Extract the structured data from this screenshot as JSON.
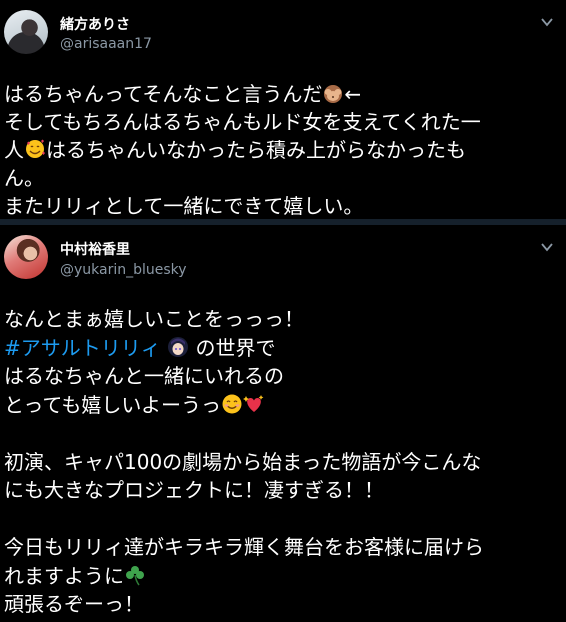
{
  "tweets": [
    {
      "display_name": "緒方ありさ",
      "handle": "@arisaaan17",
      "lines": {
        "l1": "はるちゃんってそんなこと言うんだ",
        "l1_arrow": "←",
        "l2": "そしてもちろんはるちゃんもルド女を支えてくれた一",
        "l3a": "人",
        "l3b": "はるちゃんいなかったら積み上がらなかったも",
        "l4": "ん。",
        "l5": "またリリィとして一緒にできて嬉しい。"
      }
    },
    {
      "display_name": "中村裕香里",
      "handle": "@yukarin_bluesky",
      "lines": {
        "l1": "なんとまぁ嬉しいことをっっっ！",
        "hashtag": "#アサルトリリィ",
        "l2b": "の世界で",
        "l3": "はるなちゃんと一緒にいれるの",
        "l4": "とっても嬉しいよーうっ",
        "l5": "初演、キャパ100の劇場から始まった物語が今こんな",
        "l6": "にも大きなプロジェクトに！凄すぎる！！",
        "l7": "今日もリリィ達がキラキラ輝く舞台をお客様に届けら",
        "l8": "れますように",
        "l9": "頑張るぞーっ！"
      }
    }
  ],
  "icons": {
    "more": "chevron-down-icon",
    "see_no_evil": "see-no-evil-monkey-emoji",
    "smiling_hearts": "smiling-face-with-hearts-emoji",
    "character": "assault-lily-character-emoji",
    "blush": "smiling-face-with-smiling-eyes-emoji",
    "sparkling_heart": "sparkling-heart-emoji",
    "shamrock": "shamrock-emoji"
  },
  "colors": {
    "background": "#000000",
    "divider": "#15202b",
    "handle": "#8b98a5",
    "hashtag": "#1d9bf0"
  }
}
